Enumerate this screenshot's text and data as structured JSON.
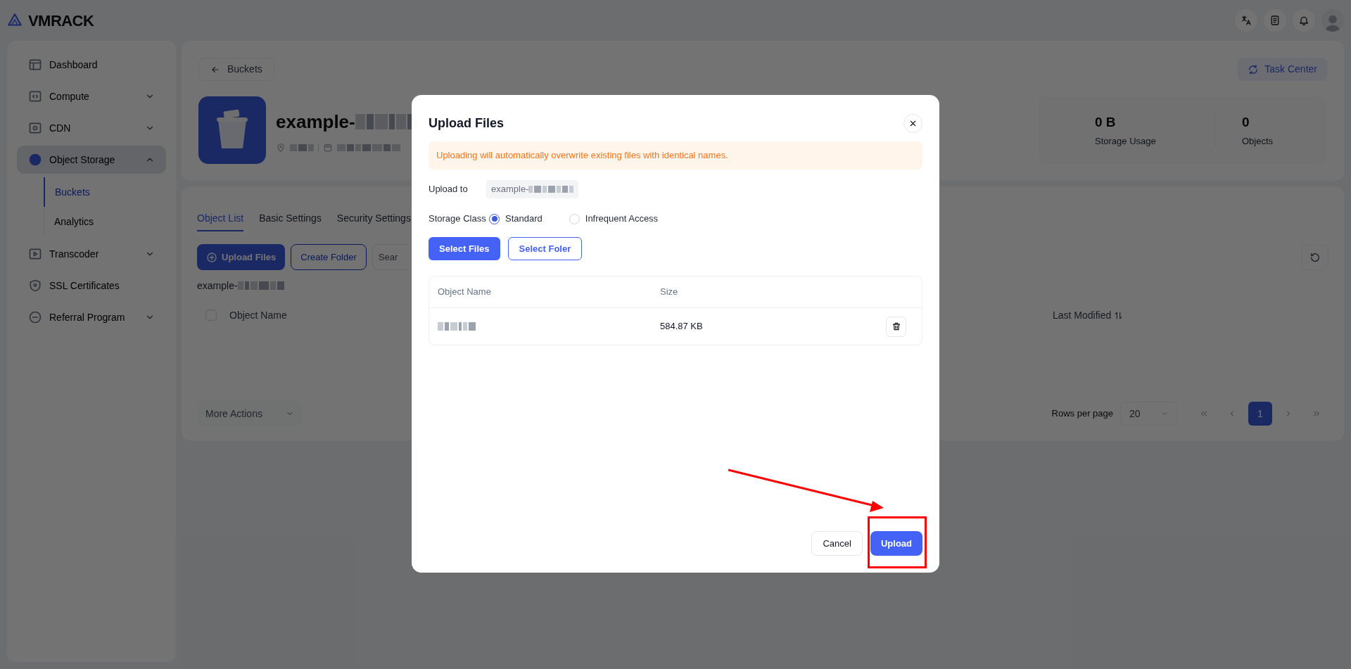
{
  "header": {
    "logo_text": "VMRACK"
  },
  "sidebar": {
    "items": [
      {
        "label": "Dashboard",
        "selected": false
      },
      {
        "label": "Compute",
        "expanded": false,
        "selected": false
      },
      {
        "label": "CDN",
        "expanded": false,
        "selected": false
      },
      {
        "label": "Object Storage",
        "expanded": true,
        "selected": true,
        "children": [
          {
            "label": "Buckets",
            "selected": true
          },
          {
            "label": "Analytics",
            "selected": false
          }
        ]
      },
      {
        "label": "Transcoder",
        "expanded": false,
        "selected": false
      },
      {
        "label": "SSL Certificates",
        "selected": false
      },
      {
        "label": "Referral Program",
        "expanded": false,
        "selected": false
      }
    ]
  },
  "page": {
    "back_button": "Buckets",
    "task_center_button": "Task Center",
    "bucket": {
      "name": "example-"
    },
    "stats": [
      {
        "value": "0 B",
        "label": "Storage Usage"
      },
      {
        "value": "0",
        "label": "Objects"
      }
    ],
    "tabs": [
      {
        "label": "Object List",
        "selected": true
      },
      {
        "label": "Basic Settings",
        "selected": false
      },
      {
        "label": "Security Settings",
        "selected": false
      }
    ],
    "toolbar": {
      "upload_button": "Upload Files",
      "create_folder_button": "Create Folder",
      "search": {
        "placeholder": "Sear"
      }
    },
    "path": "example-",
    "table": {
      "columns": [
        "Object Name",
        "Last Modified"
      ],
      "select_all": {
        "checked": false
      }
    },
    "footer": {
      "more_actions": "More Actions",
      "rows_per_page_label": "Rows per page",
      "rows_per_page": "20",
      "pages": [
        {
          "label": "1",
          "selected": true
        }
      ]
    }
  },
  "modal": {
    "title": "Upload Files",
    "alert": "Uploading will automatically overwrite existing files with identical names.",
    "upload_to": {
      "label": "Upload to",
      "value": "example-"
    },
    "storage_class": {
      "label": "Storage Class",
      "options": [
        {
          "label": "Standard",
          "selected": true
        },
        {
          "label": "Infrequent Access",
          "selected": false
        }
      ]
    },
    "select_files_button": "Select Files",
    "select_folder_button": "Select Foler",
    "files_table": {
      "columns": [
        "Object Name",
        "Size"
      ],
      "rows": [
        {
          "size": "584.87 KB"
        }
      ]
    },
    "cancel_button": "Cancel",
    "upload_button": "Upload"
  }
}
